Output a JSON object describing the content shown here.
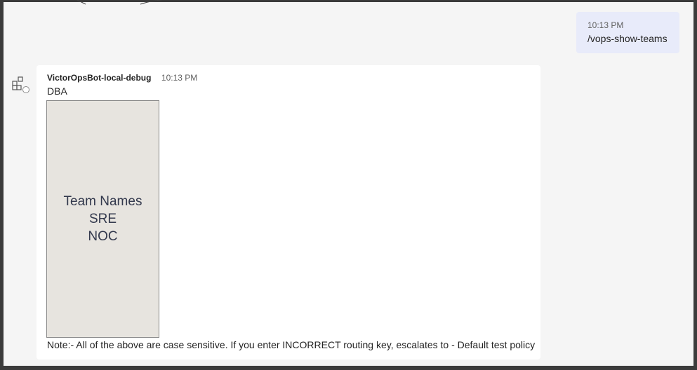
{
  "sent_message": {
    "time": "10:13 PM",
    "text": "/vops-show-teams"
  },
  "bot_message": {
    "author": "VictorOpsBot-local-debug",
    "time": "10:13 PM",
    "first_line": "DBA",
    "card_lines": [
      "Team Names",
      "SRE",
      "NOC"
    ],
    "note": "Note:- All of the above are case sensitive. If you enter INCORRECT routing key, escalates to - Default test policy"
  },
  "icons": {
    "bot_avatar": "apps-icon",
    "presence": "status-offline-icon"
  },
  "colors": {
    "sent_bubble": "#e8ebfa",
    "card_bg": "#ffffff",
    "team_card_bg": "#e7e4df",
    "frame": "#3b3b3b",
    "page_bg": "#f5f5f5"
  }
}
